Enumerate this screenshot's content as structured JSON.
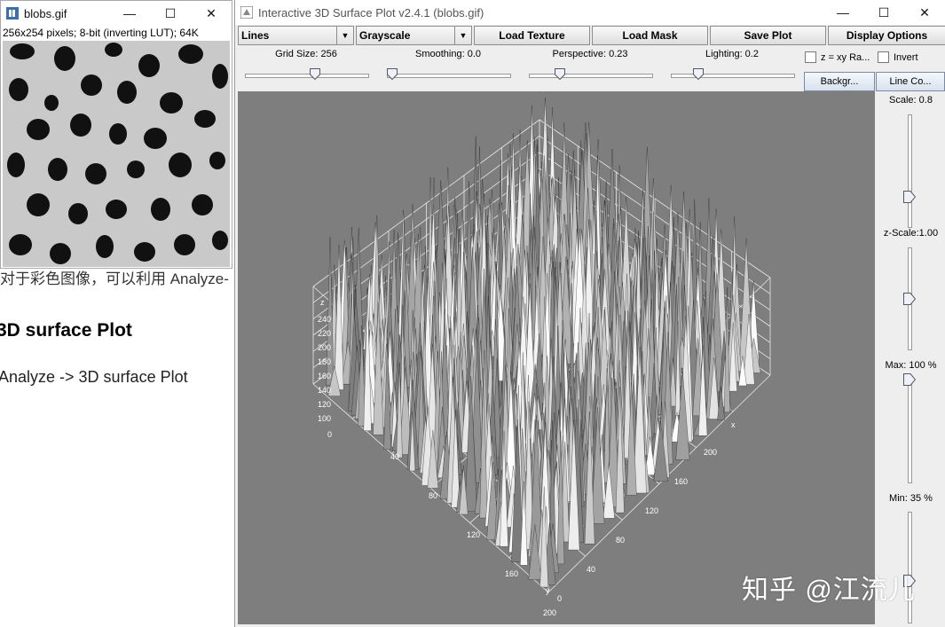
{
  "background_page": {
    "text_line": "对于彩色图像，可以利用 Analyze-",
    "heading": "3D surface Plot",
    "path_text": "Analyze -> 3D surface Plot"
  },
  "image_window": {
    "title": "blobs.gif",
    "info": "256x254 pixels; 8-bit (inverting LUT); 64K",
    "icon": "imagej-icon"
  },
  "plot_window": {
    "title": "Interactive 3D Surface Plot v2.4.1  (blobs.gif)",
    "controls": {
      "minimize": "—",
      "maximize": "☐",
      "close": "✕"
    },
    "toolbar": {
      "style_select": "Lines",
      "colormap_select": "Grayscale",
      "load_texture": "Load Texture",
      "load_mask": "Load Mask",
      "save_plot": "Save Plot",
      "display_options": "Display Options"
    },
    "sliders": {
      "grid_size": {
        "label": "Grid Size: 256",
        "level": 0.58
      },
      "smoothing": {
        "label": "Smoothing: 0.0",
        "level": 0.0
      },
      "perspective": {
        "label": "Perspective: 0.23",
        "level": 0.23
      },
      "lighting": {
        "label": "Lighting: 0.2",
        "level": 0.2
      }
    },
    "options": {
      "z_xy_ratio": "z = xy Ra...",
      "invert": "Invert",
      "background_button": "Backgr...",
      "line_color_button": "Line Co..."
    },
    "side_sliders": {
      "scale": {
        "label": "Scale: 0.8",
        "level": 0.4
      },
      "z_scale": {
        "label": "z-Scale:1.00",
        "level": 0.5
      },
      "max": {
        "label": "Max: 100 %",
        "level": 1.0
      },
      "min": {
        "label": "Min: 35 %",
        "level": 0.35
      }
    },
    "axes": {
      "z_label": "z",
      "z_ticks": [
        "240",
        "220",
        "200",
        "180",
        "160",
        "140",
        "120",
        "100",
        "0"
      ],
      "x_label": "x",
      "x_ticks": [
        "200",
        "160",
        "120",
        "80",
        "40",
        "0"
      ],
      "y_label": "y",
      "y_ticks": [
        "40",
        "80",
        "120",
        "160",
        "200"
      ]
    },
    "colors": {
      "plot_bg": "#7e7e7e",
      "surface": "#ffffff"
    }
  },
  "watermark": "知乎 @江流儿"
}
